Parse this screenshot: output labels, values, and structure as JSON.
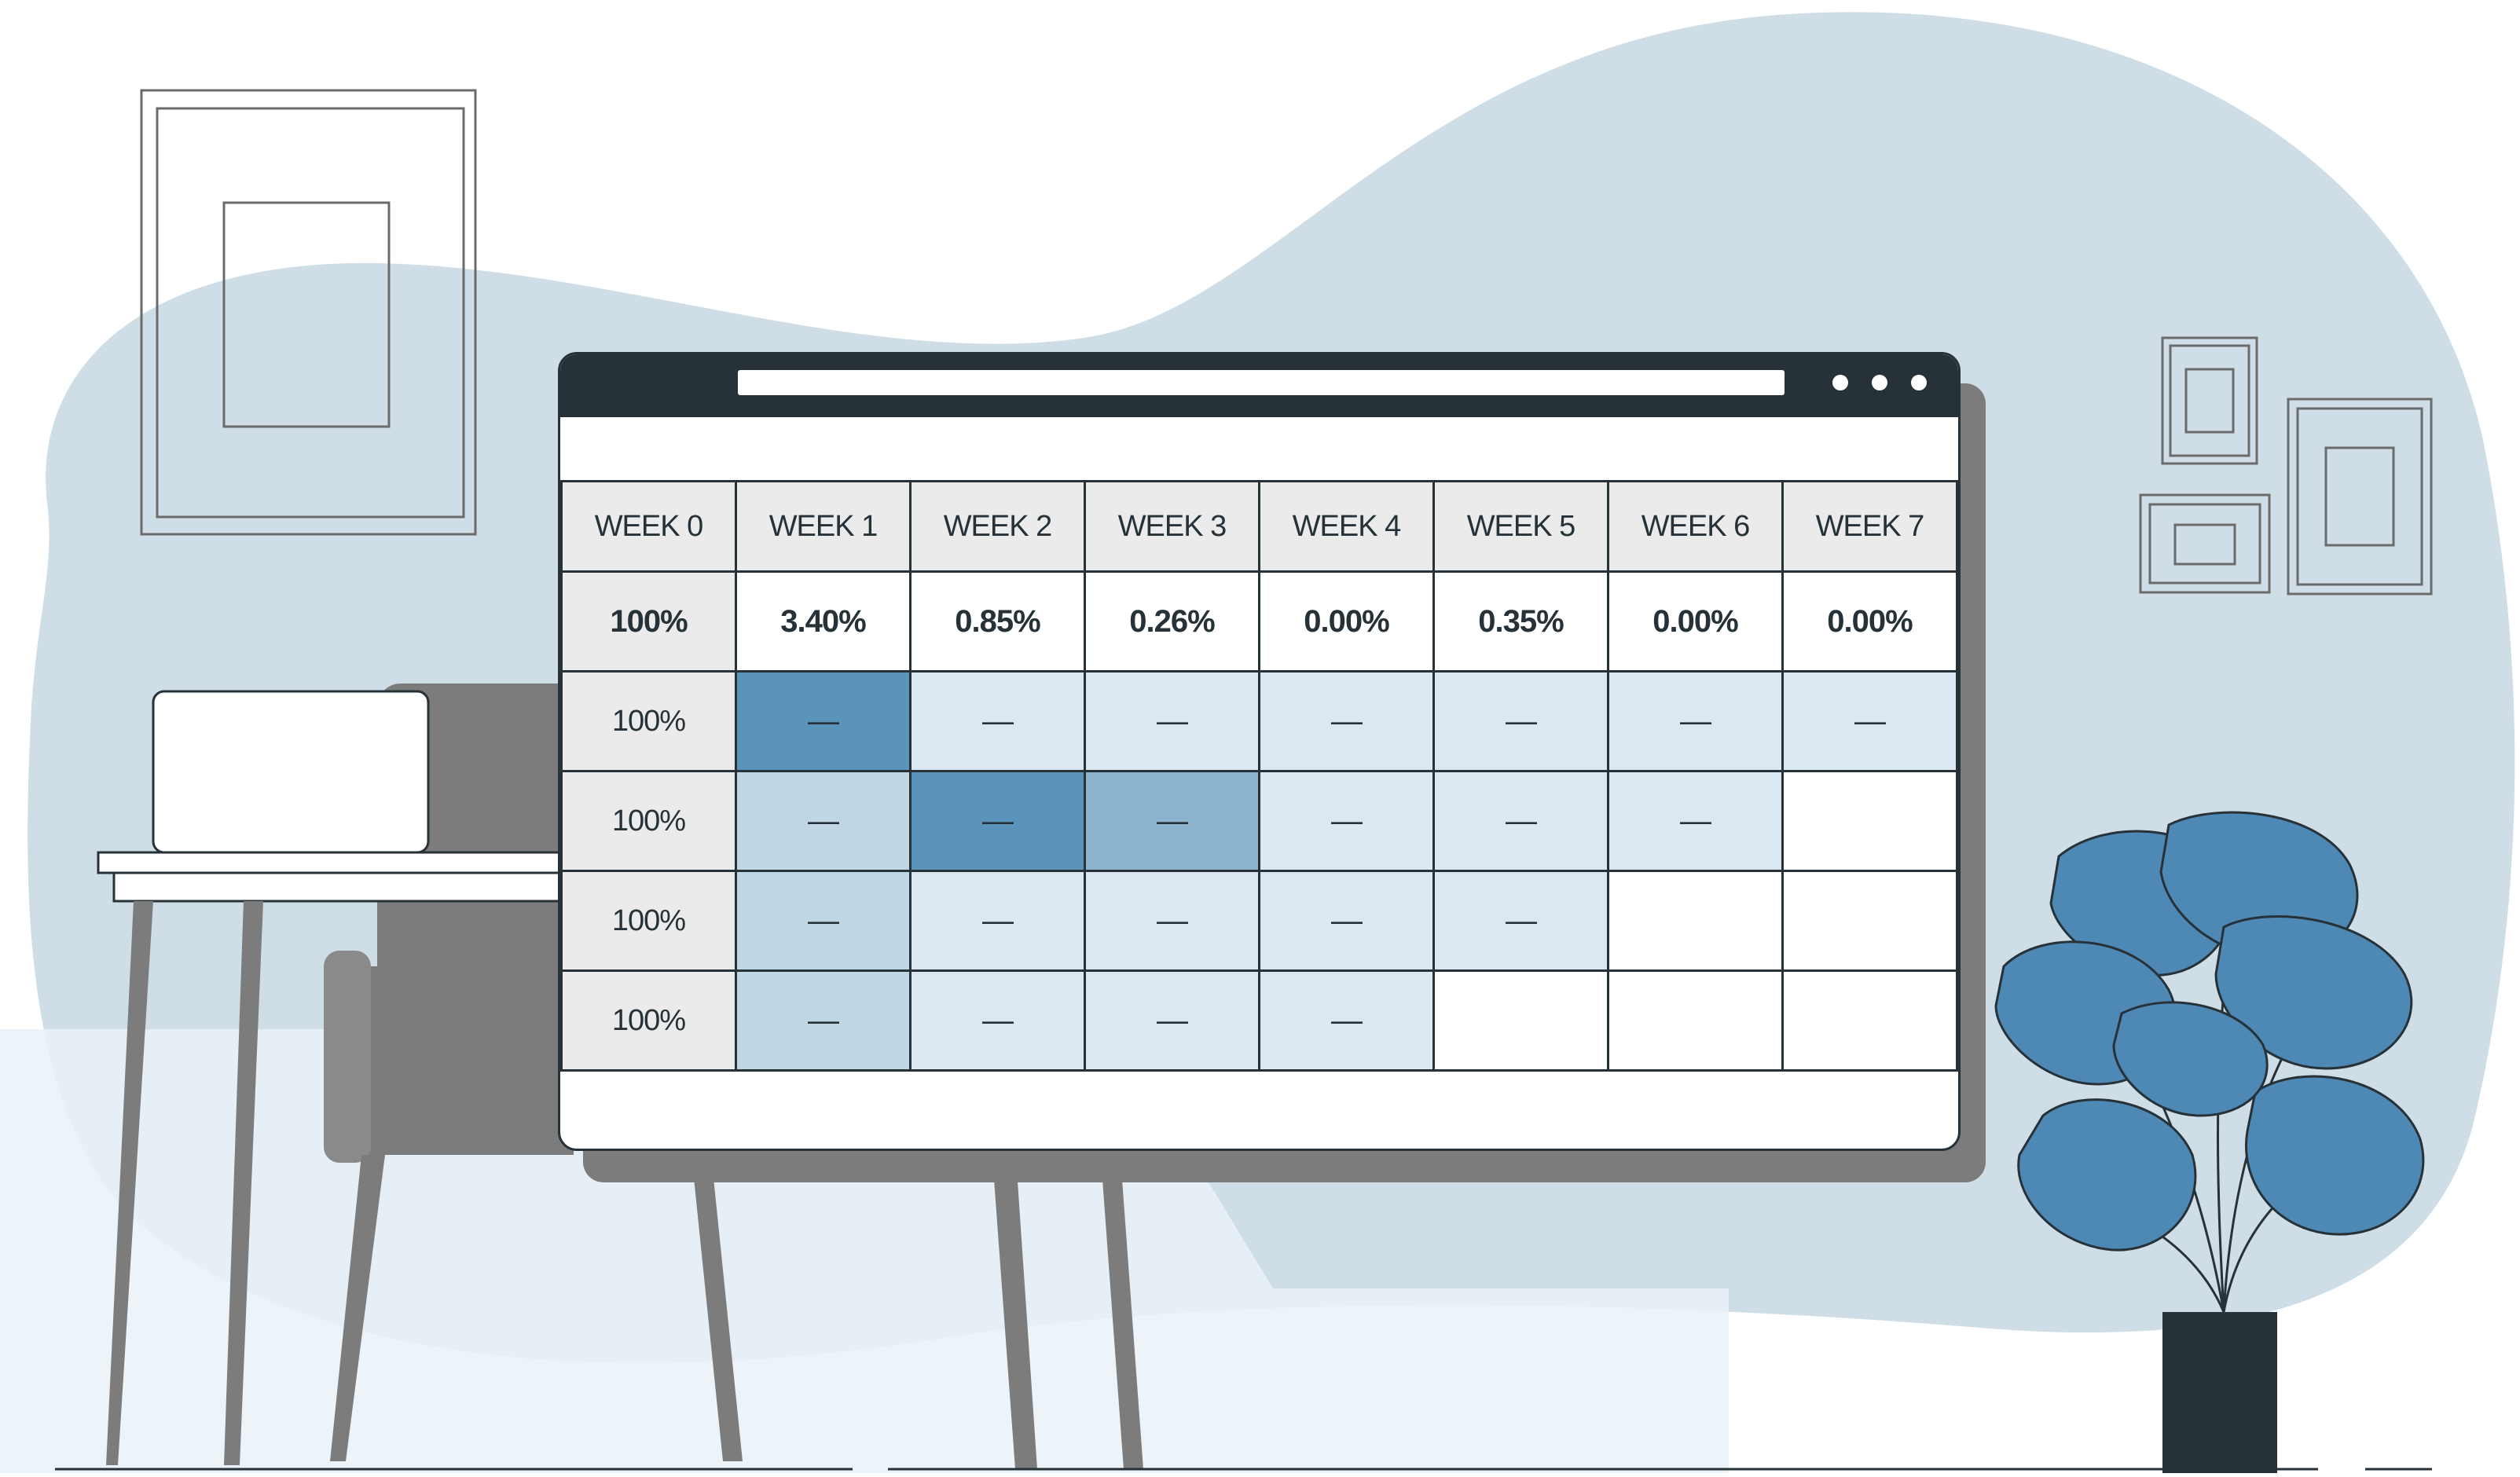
{
  "table": {
    "headers": [
      "WEEK 0",
      "WEEK 1",
      "WEEK 2",
      "WEEK 3",
      "WEEK 4",
      "WEEK 5",
      "WEEK 6",
      "WEEK 7"
    ],
    "retention": [
      "100%",
      "3.40%",
      "0.85%",
      "0.26%",
      "0.00%",
      "0.35%",
      "0.00%",
      "0.00%"
    ],
    "cohorts": [
      {
        "label": "100%",
        "cells": [
          {
            "text": "—",
            "shade": "dark"
          },
          {
            "text": "—",
            "shade": "light"
          },
          {
            "text": "—",
            "shade": "light"
          },
          {
            "text": "—",
            "shade": "light"
          },
          {
            "text": "—",
            "shade": "light"
          },
          {
            "text": "—",
            "shade": "light"
          },
          {
            "text": "—",
            "shade": "light"
          }
        ]
      },
      {
        "label": "100%",
        "cells": [
          {
            "text": "—",
            "shade": "mid"
          },
          {
            "text": "—",
            "shade": "dark"
          },
          {
            "text": "—",
            "shade": "med"
          },
          {
            "text": "—",
            "shade": "light"
          },
          {
            "text": "—",
            "shade": "light"
          },
          {
            "text": "—",
            "shade": "light"
          },
          {
            "text": "",
            "shade": "empty"
          }
        ]
      },
      {
        "label": "100%",
        "cells": [
          {
            "text": "—",
            "shade": "mid"
          },
          {
            "text": "—",
            "shade": "light"
          },
          {
            "text": "—",
            "shade": "light"
          },
          {
            "text": "—",
            "shade": "light"
          },
          {
            "text": "—",
            "shade": "light"
          },
          {
            "text": "",
            "shade": "empty"
          },
          {
            "text": "",
            "shade": "empty"
          }
        ]
      },
      {
        "label": "100%",
        "cells": [
          {
            "text": "—",
            "shade": "mid"
          },
          {
            "text": "—",
            "shade": "light"
          },
          {
            "text": "—",
            "shade": "light"
          },
          {
            "text": "—",
            "shade": "light"
          },
          {
            "text": "",
            "shade": "empty"
          },
          {
            "text": "",
            "shade": "empty"
          },
          {
            "text": "",
            "shade": "empty"
          }
        ]
      }
    ]
  },
  "icons": [
    "picture-frame-icon",
    "laptop-icon",
    "desk-icon",
    "chair-icon",
    "monstera-plant-icon",
    "window-dots-icon"
  ],
  "colors": {
    "background_blob": "#cfdde7",
    "floor_light": "#eaf2f8",
    "titlebar": "#263238",
    "shade_dark": "#5b94bb",
    "shade_med": "#8db4ce",
    "shade_mid": "#bfd6e5",
    "shade_light": "#dce8f1",
    "header_gray": "#ebebeb",
    "furniture_gray": "#7c7c7c",
    "plant_blue": "#4e88b5"
  }
}
